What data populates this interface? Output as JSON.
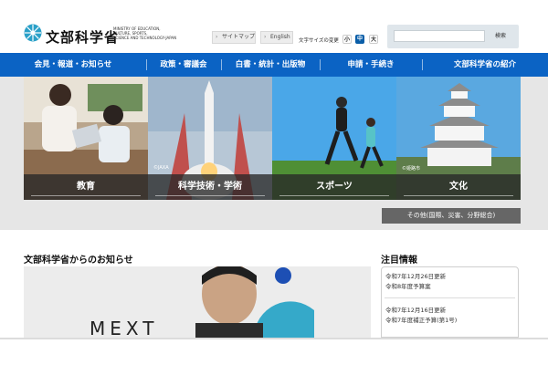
{
  "header": {
    "logo_jp": "文部科学省",
    "logo_en": "MINISTRY OF EDUCATION,\nCULTURE, SPORTS,\nSCIENCE AND TECHNOLOGY-JAPAN",
    "sitemap_label": "サイトマップ",
    "english_label": "English",
    "font_size_label": "文字サイズの変更",
    "font_small": "小",
    "font_medium": "中",
    "font_large": "大",
    "search_value": "",
    "search_button": "検索"
  },
  "nav": {
    "items": [
      {
        "label": "会見・報道・お知らせ"
      },
      {
        "label": "政策・審議会"
      },
      {
        "label": "白書・統計・出版物"
      },
      {
        "label": "申請・手続き"
      },
      {
        "label": "文部科学省の紹介"
      }
    ]
  },
  "hero": {
    "tiles": [
      {
        "label": "教育"
      },
      {
        "label": "科学技術・学術"
      },
      {
        "label": "スポーツ"
      },
      {
        "label": "文化"
      }
    ],
    "credit_rocket": "©JAXA",
    "credit_castle": "©姫路市",
    "other_button": "その他(国際、災害、分野総合)"
  },
  "news": {
    "heading": "文部科学省からのお知らせ",
    "feature_text": "MEXT"
  },
  "attention": {
    "heading": "注目情報",
    "items": [
      {
        "date": "令和7年12月26日更新",
        "title": "令和8年度予算案"
      },
      {
        "date": "令和7年12月16日更新",
        "title": "令和7年度補正予算(第1号)"
      }
    ]
  },
  "colors": {
    "nav_blue": "#0b63c4",
    "logo_teal": "#2aa0c8"
  }
}
